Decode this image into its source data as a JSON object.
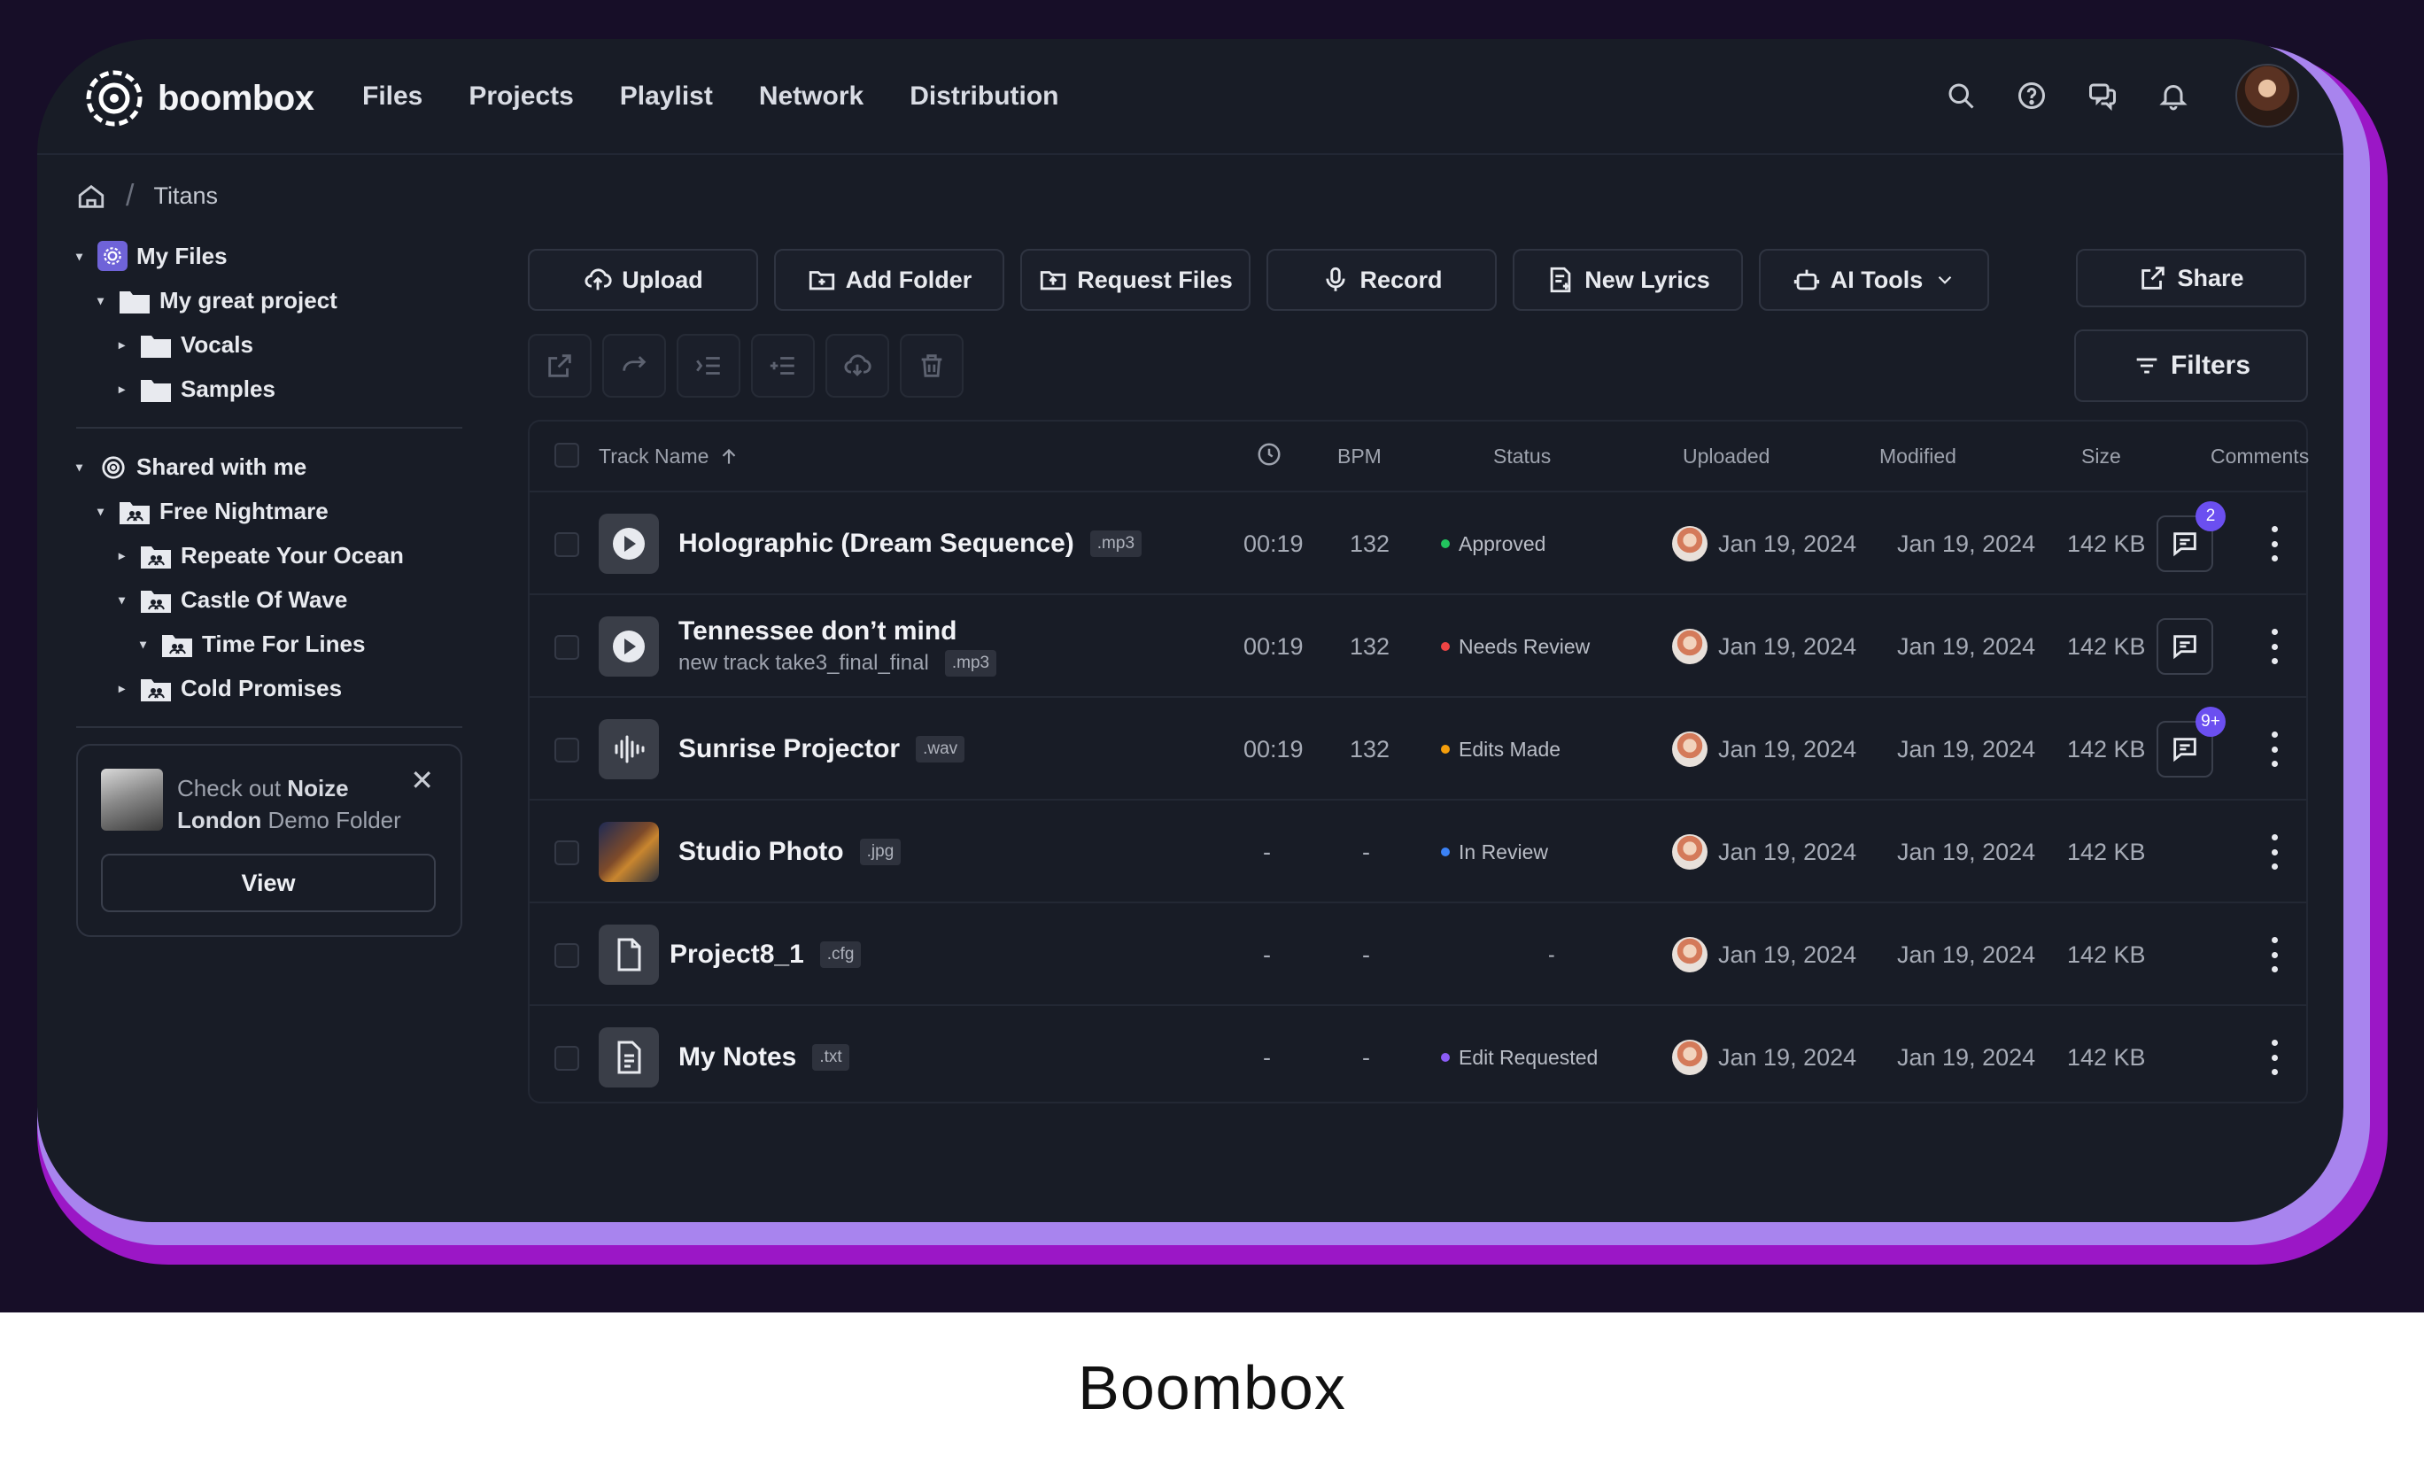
{
  "app": {
    "name": "boombox"
  },
  "nav": [
    "Files",
    "Projects",
    "Playlist",
    "Network",
    "Distribution"
  ],
  "breadcrumb": {
    "current": "Titans"
  },
  "sidebar": {
    "my_files": "My Files",
    "my_files_items": [
      {
        "label": "My great project",
        "depth": 1,
        "expanded": true
      },
      {
        "label": "Vocals",
        "depth": 2,
        "expanded": false
      },
      {
        "label": "Samples",
        "depth": 2,
        "expanded": false
      }
    ],
    "shared": "Shared with me",
    "shared_items": [
      {
        "label": "Free Nightmare",
        "depth": 1,
        "expanded": true
      },
      {
        "label": "Repeate Your Ocean",
        "depth": 2,
        "expanded": false
      },
      {
        "label": "Castle Of Wave",
        "depth": 2,
        "expanded": true
      },
      {
        "label": "Time For Lines",
        "depth": 3,
        "expanded": true
      },
      {
        "label": "Cold Promises",
        "depth": 2,
        "expanded": false
      }
    ],
    "promo": {
      "prefix": "Check out ",
      "bold1": "Noize",
      "bold2": "London",
      "suffix": " Demo Folder",
      "button": "View"
    }
  },
  "toolbar": {
    "upload": "Upload",
    "add_folder": "Add Folder",
    "request_files": "Request Files",
    "record": "Record",
    "new_lyrics": "New Lyrics",
    "ai_tools": "AI Tools",
    "share": "Share",
    "filters": "Filters"
  },
  "table": {
    "headers": {
      "name": "Track Name",
      "bpm": "BPM",
      "status": "Status",
      "uploaded": "Uploaded",
      "modified": "Modified",
      "size": "Size",
      "comments": "Comments"
    },
    "rows": [
      {
        "name": "Holographic (Dream Sequence)",
        "sub": "",
        "ext": ".mp3",
        "kind": "play",
        "duration": "00:19",
        "bpm": "132",
        "status": "Approved",
        "status_color": "#22c55e",
        "uploaded": "Jan 19, 2024",
        "modified": "Jan 19, 2024",
        "size": "142 KB",
        "comments": true,
        "badge": "2"
      },
      {
        "name": "Tennessee don’t mind",
        "sub": "new track take3_final_final",
        "ext": ".mp3",
        "kind": "play",
        "duration": "00:19",
        "bpm": "132",
        "status": "Needs Review",
        "status_color": "#ef4444",
        "uploaded": "Jan 19, 2024",
        "modified": "Jan 19, 2024",
        "size": "142 KB",
        "comments": true,
        "badge": ""
      },
      {
        "name": "Sunrise Projector",
        "sub": "",
        "ext": ".wav",
        "kind": "wave",
        "duration": "00:19",
        "bpm": "132",
        "status": "Edits Made",
        "status_color": "#f59e0b",
        "uploaded": "Jan 19, 2024",
        "modified": "Jan 19, 2024",
        "size": "142 KB",
        "comments": true,
        "badge": "9+"
      },
      {
        "name": "Studio Photo",
        "sub": "",
        "ext": ".jpg",
        "kind": "photo",
        "duration": "-",
        "bpm": "-",
        "status": "In Review",
        "status_color": "#3b82f6",
        "uploaded": "Jan 19, 2024",
        "modified": "Jan 19, 2024",
        "size": "142 KB",
        "comments": false,
        "badge": ""
      },
      {
        "name": "Project8_1",
        "sub": "",
        "ext": ".cfg",
        "kind": "file",
        "duration": "-",
        "bpm": "-",
        "status": "-",
        "status_color": "",
        "uploaded": "Jan 19, 2024",
        "modified": "Jan 19, 2024",
        "size": "142 KB",
        "comments": false,
        "badge": ""
      },
      {
        "name": "My Notes",
        "sub": "",
        "ext": ".txt",
        "kind": "doc",
        "duration": "-",
        "bpm": "-",
        "status": "Edit Requested",
        "status_color": "#8b5cf6",
        "uploaded": "Jan 19, 2024",
        "modified": "Jan 19, 2024",
        "size": "142 KB",
        "comments": false,
        "badge": ""
      }
    ]
  },
  "caption": "Boombox"
}
